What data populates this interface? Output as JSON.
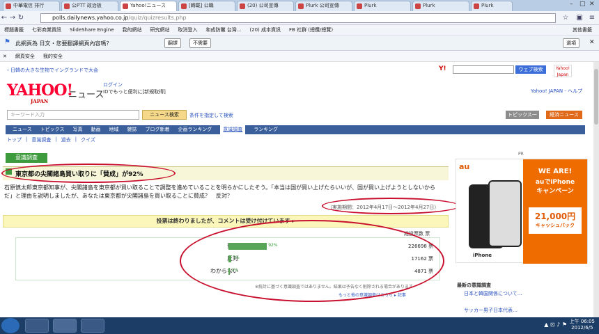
{
  "browser": {
    "tabs": [
      "中華電信 排行",
      "公PTT 政治板",
      "Yahoo!ニュース",
      "[轉載] 公職",
      "(20) 公司宣傳",
      "Plurk 公司宣傳",
      "Plurk",
      "Plurk",
      "Plurk",
      "Plurk"
    ],
    "url_host": "polls.dailynews.yahoo.co.jp",
    "url_path": "/quiz/quizresults.php",
    "bookmarks": [
      "標題書籤",
      "七彩商業資訊",
      "SlideShare Engine",
      "我的網站",
      "研究網站",
      "取消登入",
      "和成防曬 台灣...",
      "(20) 成本資訊",
      "FB 社群 (總攬/總覽)",
      "其他書籤"
    ],
    "translate_label": "此網頁為 日文・您要翻譯網頁內容嗎？",
    "translate_btn": "翻譯",
    "no_btn": "不需要",
    "options_btn": "選項",
    "addons": [
      "網頁安全",
      "我的安全"
    ]
  },
  "page": {
    "top_link": "・日韓の大きな生物でイングランドで大会",
    "search_btn": "ウェブ検索",
    "yahoo_icon_label": "Yahoo! Japan",
    "logo": "YAHOO!",
    "logo_sub": "JAPAN",
    "news_label": "ニュース",
    "login": "ログイン",
    "login_hint": "IDでもっと便利に[新規取得]",
    "yj_links": "Yahoo! JAPAN - ヘルプ",
    "keyword_placeholder": "キーワード入力",
    "news_search_btn": "ニュース検索",
    "adv_link": "条件を指定して検索",
    "rbtn1": "トピックス一覧",
    "rbtn2": "経済ニュース",
    "gnav": [
      "ニュース",
      "トピックス",
      "写真",
      "動画",
      "地域",
      "雑誌",
      "ブログ新着",
      "企画ランキング",
      "意識調査",
      "ランキング"
    ],
    "subnav": [
      "トップ",
      "意識調査",
      "過去",
      "クイズ"
    ],
    "section": "意識調査",
    "question": "東京都の尖閣諸島買い取りに「賛成」が92%",
    "description": "石原慎太郎東京都知事が、尖閣諸島を東京都が買い取ることで調整を進めていることを明らかにしたそう。「本当は国が買い上げたらいいが、国が買い上げようとしないからだ」と理由を説明しましたが、あなたは東京都が尖閣諸島を買い取ることに賛成？　反対？",
    "period": "（実施期間：2012年4月17日〜2012年4月27日）",
    "voted_msg": "投票は終わりましたが、コメントは受け付けています ▸",
    "votes_header": "総投票数 票",
    "results": [
      {
        "label": "賛成",
        "percent": 92,
        "pct_text": "92%",
        "count": "226698 票"
      },
      {
        "label": "反対",
        "percent": 7,
        "pct_text": "7%",
        "count": "17162 票"
      },
      {
        "label": "わからない",
        "percent": 2,
        "pct_text": "2%",
        "count": "4871 票"
      }
    ],
    "note": "※統計に基づく意識調査ではありません。結果は予告なく削除される場合があります",
    "note_link": "もっと他の意識調査はこちら ▸ 記事",
    "pr": "PR",
    "ad": {
      "brand": "au",
      "line1": "WE ARE!",
      "line2": "auでiPhone",
      "line3": "キャンペーン",
      "amount": "21,000円",
      "cashback": "キャッシュバック",
      "iphone": "iPhone"
    },
    "latest_title": "最新の意識調査",
    "latest_items": [
      "日本と韓国関係について…",
      "サッカー男子日本代表…"
    ]
  },
  "taskbar": {
    "time": "上午 06:05",
    "date": "2012/6/5"
  }
}
